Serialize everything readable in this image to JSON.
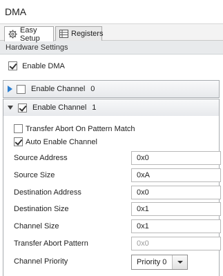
{
  "window": {
    "title": "DMA"
  },
  "tabs": [
    {
      "label": "Easy Setup",
      "icon": "gear-icon",
      "active": true
    },
    {
      "label": "Registers",
      "icon": "registers-icon",
      "active": false
    }
  ],
  "section": {
    "title": "Hardware Settings"
  },
  "enable_dma": {
    "label": "Enable DMA",
    "checked": true
  },
  "channel0": {
    "label": "Enable Channel",
    "index": "0",
    "checked": false,
    "expanded": false
  },
  "channel1": {
    "label": "Enable Channel",
    "index": "1",
    "checked": true,
    "expanded": true,
    "options": {
      "transfer_abort": {
        "label": "Transfer Abort On Pattern Match",
        "checked": false
      },
      "auto_enable": {
        "label": "Auto Enable Channel",
        "checked": true
      }
    },
    "fields": {
      "source_address": {
        "label": "Source Address",
        "value": "0x0"
      },
      "source_size": {
        "label": "Source Size",
        "value": "0xA"
      },
      "destination_address": {
        "label": "Destination Address",
        "value": "0x0"
      },
      "destination_size": {
        "label": "Destination Size",
        "value": "0x1"
      },
      "channel_size": {
        "label": "Channel Size",
        "value": "0x1"
      },
      "transfer_abort_pattern": {
        "label": "Transfer Abort Pattern",
        "value": "",
        "placeholder": "0x0"
      },
      "channel_priority": {
        "label": "Channel Priority",
        "value": "Priority 0"
      }
    }
  }
}
